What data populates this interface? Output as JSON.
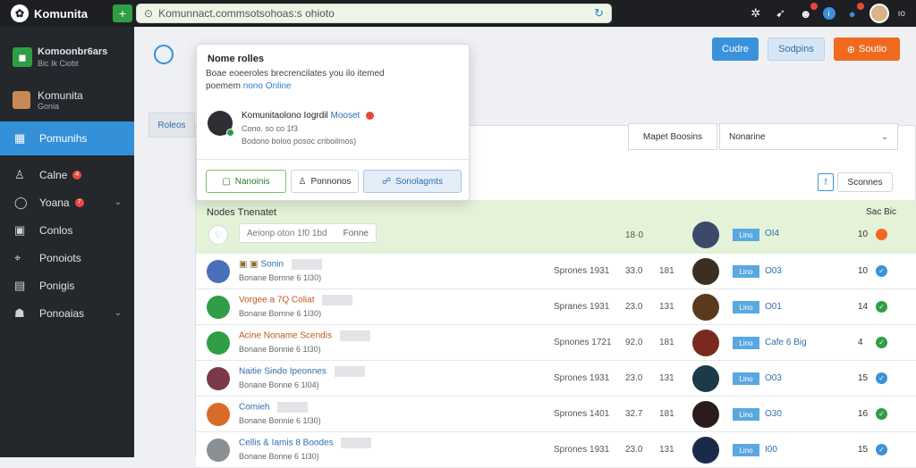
{
  "topbar": {
    "brand": "Komunita",
    "url": "Komunnact.commsotsohoas:s ohioto",
    "lang": "ıo"
  },
  "sidebar": {
    "header_title": "Komoonbr6ars",
    "header_sub": "Bic Ik Ciobt",
    "user_name": "Komunita",
    "user_sub": "Gonia",
    "items": [
      {
        "label": "Pomunihs",
        "icon": "home-icon"
      },
      {
        "label": "Calne",
        "icon": "user-icon",
        "badge": "4"
      },
      {
        "label": "Yoana",
        "icon": "chat-icon",
        "badge": "7"
      },
      {
        "label": "Conlos",
        "icon": "image-icon"
      },
      {
        "label": "Ponoiots",
        "icon": "location-icon"
      },
      {
        "label": "Ponigis",
        "icon": "document-icon"
      },
      {
        "label": "Ponoaias",
        "icon": "people-icon"
      }
    ]
  },
  "main": {
    "tab_left": "Roleos",
    "buttons": {
      "b1": "Cudre",
      "b2": "Sodpins",
      "b3": "Soutio"
    },
    "filter_label": "Mapet Boosins",
    "select_value": "Nonarine",
    "search_btn": "Sconnes",
    "green_head": {
      "title": "Nodes Tnenatet",
      "right": "Sac Bic",
      "input_text": "Aeionp oton 1f0 1bd",
      "input_end": "Fonne",
      "num": "18·0",
      "tag": "Lino",
      "code": "OI4",
      "count": "10"
    },
    "rows": [
      {
        "title": "Sonin",
        "title_pre": "▣ ▣",
        "title_style": "blue",
        "sub": "Bonane Bomne 6 1Ɩ30)",
        "date": "Sprones 1931",
        "n1": "33.0",
        "n2": "181",
        "tag": "Lino",
        "code": "O03",
        "count": "10",
        "dot_color": "#3a92da",
        "av_color": "#4a6fb8",
        "thumb_color": "#3b2f22"
      },
      {
        "title": "Vorgee a 7Q Coliat",
        "title_pre": "",
        "title_style": "orange",
        "sub": "Bonane Bomne 6 1Ɩ30)",
        "date": "Spranes 1931",
        "n1": "23.0",
        "n2": "131",
        "tag": "Lino",
        "code": "O01",
        "count": "14",
        "dot_color": "#2f9e44",
        "av_color": "#2f9e44",
        "thumb_color": "#5a3a1c"
      },
      {
        "title": "Acine Noname Scendis",
        "title_pre": "",
        "title_style": "orange",
        "sub": "Bonane Bonnie 6 1Ɩ30)",
        "date": "Spnones 1721",
        "n1": "92.0",
        "n2": "181",
        "tag": "Lino",
        "code": "Cafe 6 Big",
        "count": "4",
        "dot_color": "#2f9e44",
        "av_color": "#2f9e44",
        "thumb_color": "#7a2a1c"
      },
      {
        "title": "Naitie Sindo Ipeonnes",
        "title_pre": "",
        "title_style": "blue",
        "sub": "Bonane Bonne 6 1Ɩ04)",
        "date": "Sprones 1931",
        "n1": "23.0",
        "n2": "131",
        "tag": "Lino",
        "code": "O03",
        "count": "15",
        "dot_color": "#3a92da",
        "av_color": "#7a3a4a",
        "thumb_color": "#1c3a4a"
      },
      {
        "title": "Comieh",
        "title_pre": "",
        "title_style": "blue",
        "sub": "Bonane Bonnie 6 1Ɩ30)",
        "date": "Sprones 1401",
        "n1": "32.7",
        "n2": "181",
        "tag": "Lino",
        "code": "O30",
        "count": "16",
        "dot_color": "#2f9e44",
        "av_color": "#d86a2a",
        "thumb_color": "#2a1c1c"
      },
      {
        "title": "Cellis & Iamis 8 Boodes",
        "title_pre": "",
        "title_style": "blue",
        "sub": "Bonane Bonne 6 1Ɩ30)",
        "date": "Sprones 1931",
        "n1": "23.0",
        "n2": "131",
        "tag": "Lino",
        "code": "I00",
        "count": "15",
        "dot_color": "#3a92da",
        "av_color": "#8a8f96",
        "thumb_color": "#1c2a4a"
      }
    ]
  },
  "popup": {
    "title": "Nome rolles",
    "desc": "Boae eoeeroles brecrencilates you ilo itemed",
    "desc2_pre": "poemem",
    "desc2_link": "nono Online",
    "aside": "",
    "name": "Komunitaolono Iogrdil",
    "name_accent": "Mooset",
    "meta1": "Cono. so co 1f3",
    "meta2": "Bodono boloo posoc criboilmos)",
    "btn_green": "Nanoinis",
    "btn_white": "Ponnonos",
    "btn_blue": "Sonolagmts"
  },
  "colors": {
    "accent": "#3490d8",
    "brand_green": "#2f9e44",
    "orange": "#ef6a1f",
    "sidebar": "#24272c"
  }
}
